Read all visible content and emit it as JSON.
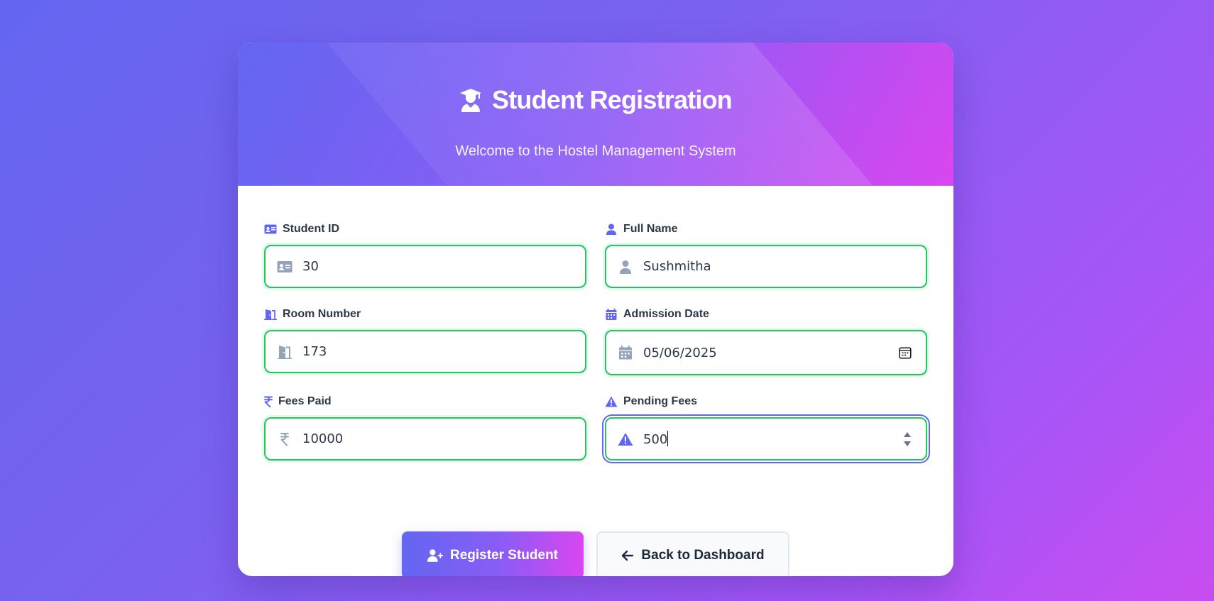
{
  "header": {
    "title": "Student Registration",
    "subtitle": "Welcome to the Hostel Management System"
  },
  "fields": {
    "student_id": {
      "label": "Student ID",
      "value": "30"
    },
    "full_name": {
      "label": "Full Name",
      "value": "Sushmitha"
    },
    "room_number": {
      "label": "Room Number",
      "value": "173"
    },
    "admission_date": {
      "label": "Admission Date",
      "value": "05/06/2025"
    },
    "fees_paid": {
      "label": "Fees Paid",
      "value": "10000"
    },
    "pending_fees": {
      "label": "Pending Fees",
      "value": "500"
    }
  },
  "buttons": {
    "register": "Register Student",
    "back": "Back to Dashboard"
  },
  "colors": {
    "accent": "#6366f1",
    "accent_end": "#d946ef",
    "valid_border": "#22c55e"
  }
}
